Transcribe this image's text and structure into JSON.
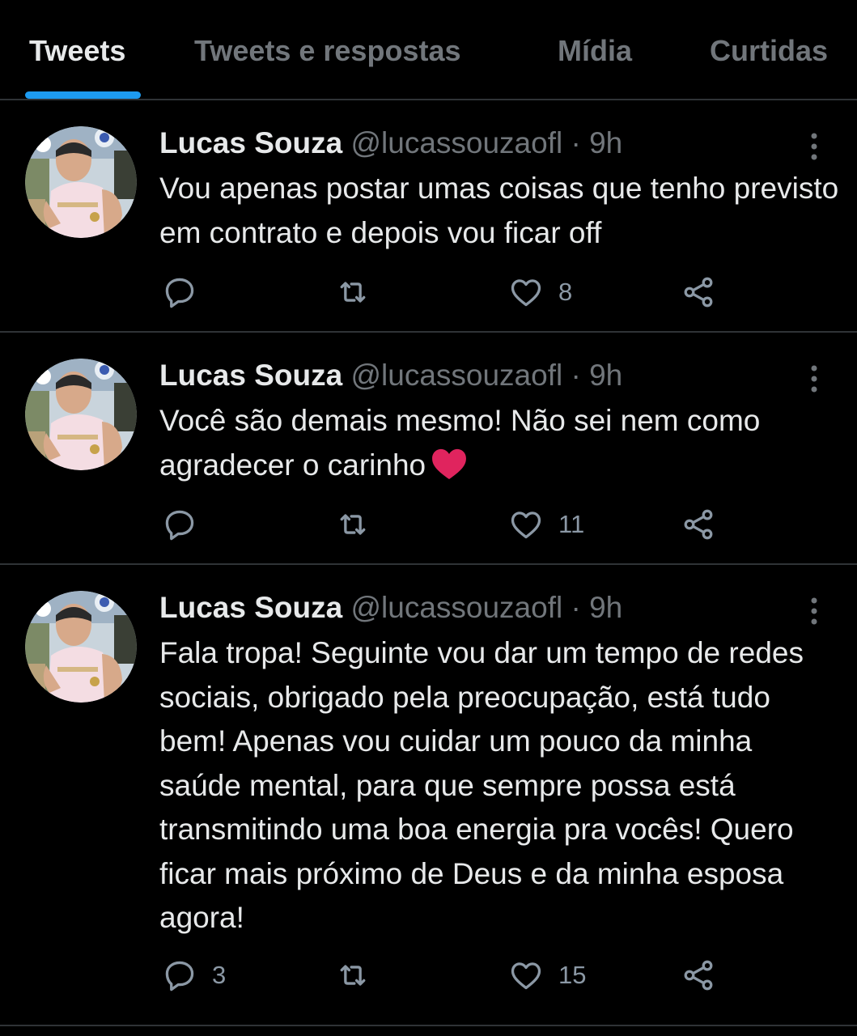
{
  "tabs": [
    {
      "label": "Tweets",
      "active": true
    },
    {
      "label": "Tweets e respostas",
      "active": false
    },
    {
      "label": "Mídia",
      "active": false
    },
    {
      "label": "Curtidas",
      "active": false
    }
  ],
  "colors": {
    "accent": "#1d9bf0",
    "text": "#e7e9ea",
    "muted": "#71767b",
    "background": "#000000",
    "heart": "#e0245e"
  },
  "tweets": [
    {
      "name": "Lucas Souza",
      "handle": "@lucassouzaofl",
      "separator": "·",
      "time": "9h",
      "text": "Vou apenas postar umas coisas que tenho previsto em contrato e depois vou ficar off",
      "emoji": "",
      "replies": "",
      "retweets": "",
      "likes": "8"
    },
    {
      "name": "Lucas Souza",
      "handle": "@lucassouzaofl",
      "separator": "·",
      "time": "9h",
      "text": "Você são demais mesmo! Não sei nem como agradecer o carinho",
      "emoji": "red-heart",
      "replies": "",
      "retweets": "",
      "likes": "11"
    },
    {
      "name": "Lucas Souza",
      "handle": "@lucassouzaofl",
      "separator": "·",
      "time": "9h",
      "text": "Fala tropa! Seguinte vou dar um tempo de redes sociais, obrigado pela preocupação, está tudo bem! Apenas vou cuidar um pouco da minha saúde mental, para que sempre possa está transmitindo uma boa energia pra vocês! Quero ficar mais próximo de Deus e da minha esposa agora!",
      "emoji": "",
      "replies": "3",
      "retweets": "",
      "likes": "15"
    }
  ]
}
